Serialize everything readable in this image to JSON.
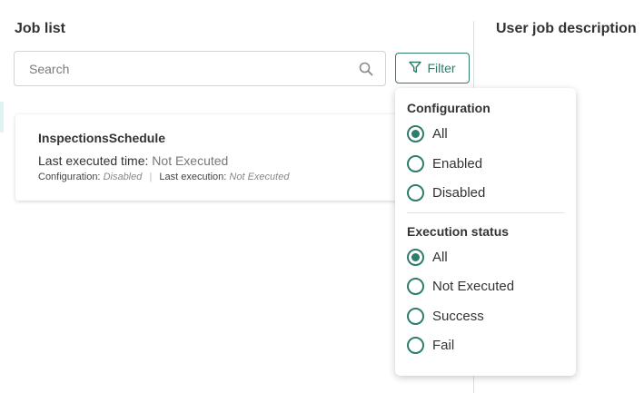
{
  "left_panel": {
    "title": "Job list",
    "search": {
      "placeholder": "Search",
      "value": ""
    },
    "filter_label": "Filter"
  },
  "right_panel": {
    "title": "User job description"
  },
  "jobs": [
    {
      "name": "InspectionsSchedule",
      "last_executed_label": "Last executed time:",
      "last_executed_value": "Not Executed",
      "configuration_label": "Configuration:",
      "configuration_value": "Disabled",
      "separator": "|",
      "last_execution_label": "Last execution:",
      "last_execution_value": "Not Executed"
    }
  ],
  "filter_popover": {
    "configuration": {
      "title": "Configuration",
      "options": [
        {
          "label": "All",
          "selected": true
        },
        {
          "label": "Enabled",
          "selected": false
        },
        {
          "label": "Disabled",
          "selected": false
        }
      ]
    },
    "execution_status": {
      "title": "Execution status",
      "options": [
        {
          "label": "All",
          "selected": true
        },
        {
          "label": "Not Executed",
          "selected": false
        },
        {
          "label": "Success",
          "selected": false
        },
        {
          "label": "Fail",
          "selected": false
        }
      ]
    }
  },
  "colors": {
    "accent": "#2e7d6b",
    "text": "#333333",
    "muted": "#7a7a7a"
  }
}
